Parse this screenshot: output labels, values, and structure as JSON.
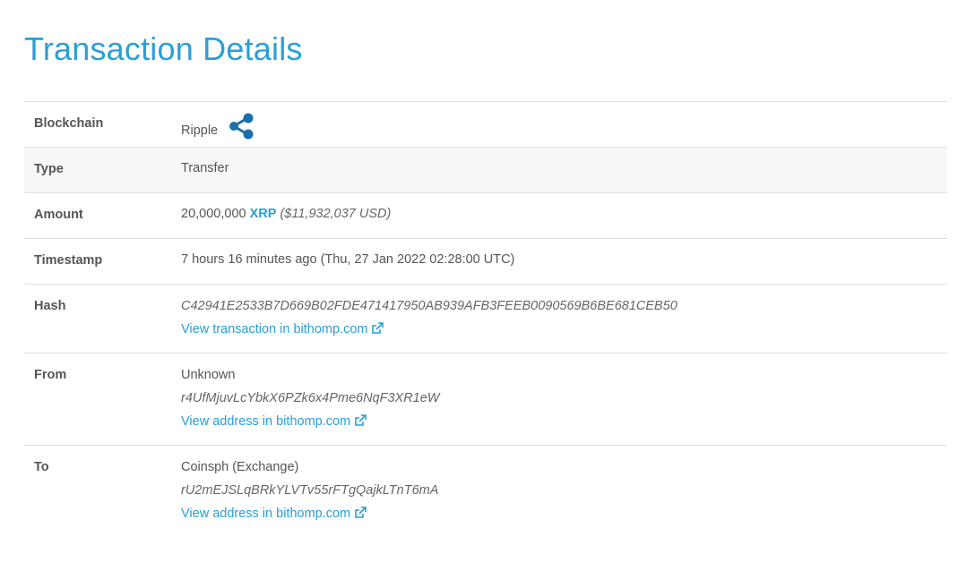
{
  "page": {
    "title": "Transaction Details"
  },
  "labels": {
    "blockchain": "Blockchain",
    "type": "Type",
    "amount": "Amount",
    "timestamp": "Timestamp",
    "hash": "Hash",
    "from": "From",
    "to": "To"
  },
  "blockchain": {
    "name": "Ripple",
    "icon": "ripple-icon"
  },
  "type": "Transfer",
  "amount": {
    "value": "20,000,000",
    "symbol": "XRP",
    "usd": "($11,932,037 USD)"
  },
  "timestamp": "7 hours 16 minutes ago (Thu, 27 Jan 2022 02:28:00 UTC)",
  "hash": {
    "value": "C42941E2533B7D669B02FDE471417950AB939AFB3FEEB0090569B6BE681CEB50",
    "link_text": "View transaction in bithomp.com"
  },
  "from": {
    "owner": "Unknown",
    "address": "r4UfMjuvLcYbkX6PZk6x4Pme6NqF3XR1eW",
    "link_text": "View address in bithomp.com"
  },
  "to": {
    "owner": "Coinsph (Exchange)",
    "address": "rU2mEJSLqBRkYLVTv55rFTgQajkLTnT6mA",
    "link_text": "View address in bithomp.com"
  },
  "colors": {
    "accent": "#2a9fd8",
    "ripple": "#1a6fa8",
    "shaded_row": "#f7f7f7"
  }
}
